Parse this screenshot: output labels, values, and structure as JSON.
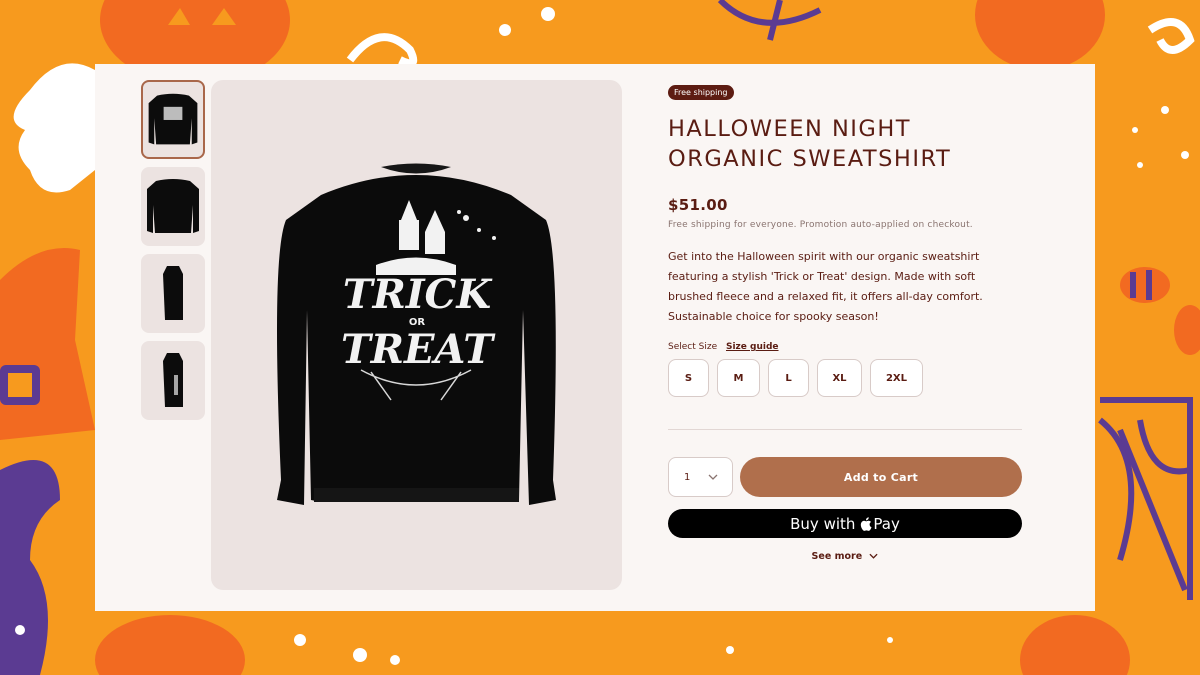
{
  "product": {
    "badge": "Free shipping",
    "title_line1": "HALLOWEEN NIGHT",
    "title_line2": "ORGANIC SWEATSHIRT",
    "price": "$51.00",
    "promo": "Free shipping for everyone. Promotion auto-applied on checkout.",
    "description": "Get into the Halloween spirit with our organic sweatshirt featuring a stylish 'Trick or Treat' design. Made with soft brushed fleece and a relaxed fit, it offers all-day comfort. Sustainable choice for spooky season!",
    "graphic_text_1": "TRICK",
    "graphic_text_or": "OR",
    "graphic_text_2": "TREAT"
  },
  "size": {
    "label": "Select Size",
    "guide": "Size guide",
    "options": [
      "S",
      "M",
      "L",
      "XL",
      "2XL"
    ]
  },
  "cart": {
    "quantity": "1",
    "add_label": "Add to Cart",
    "pay_prefix": "Buy with",
    "pay_suffix": "Pay",
    "see_more": "See more"
  },
  "icons": {
    "quantity": "chevron-down-icon",
    "see_more": "chevron-down-icon",
    "pay": "apple-icon"
  },
  "colors": {
    "background": "#f79a1e",
    "card": "#faf6f4",
    "brand_text": "#5a1c12",
    "accent_button": "#b06f4c",
    "pay_button": "#000000"
  }
}
